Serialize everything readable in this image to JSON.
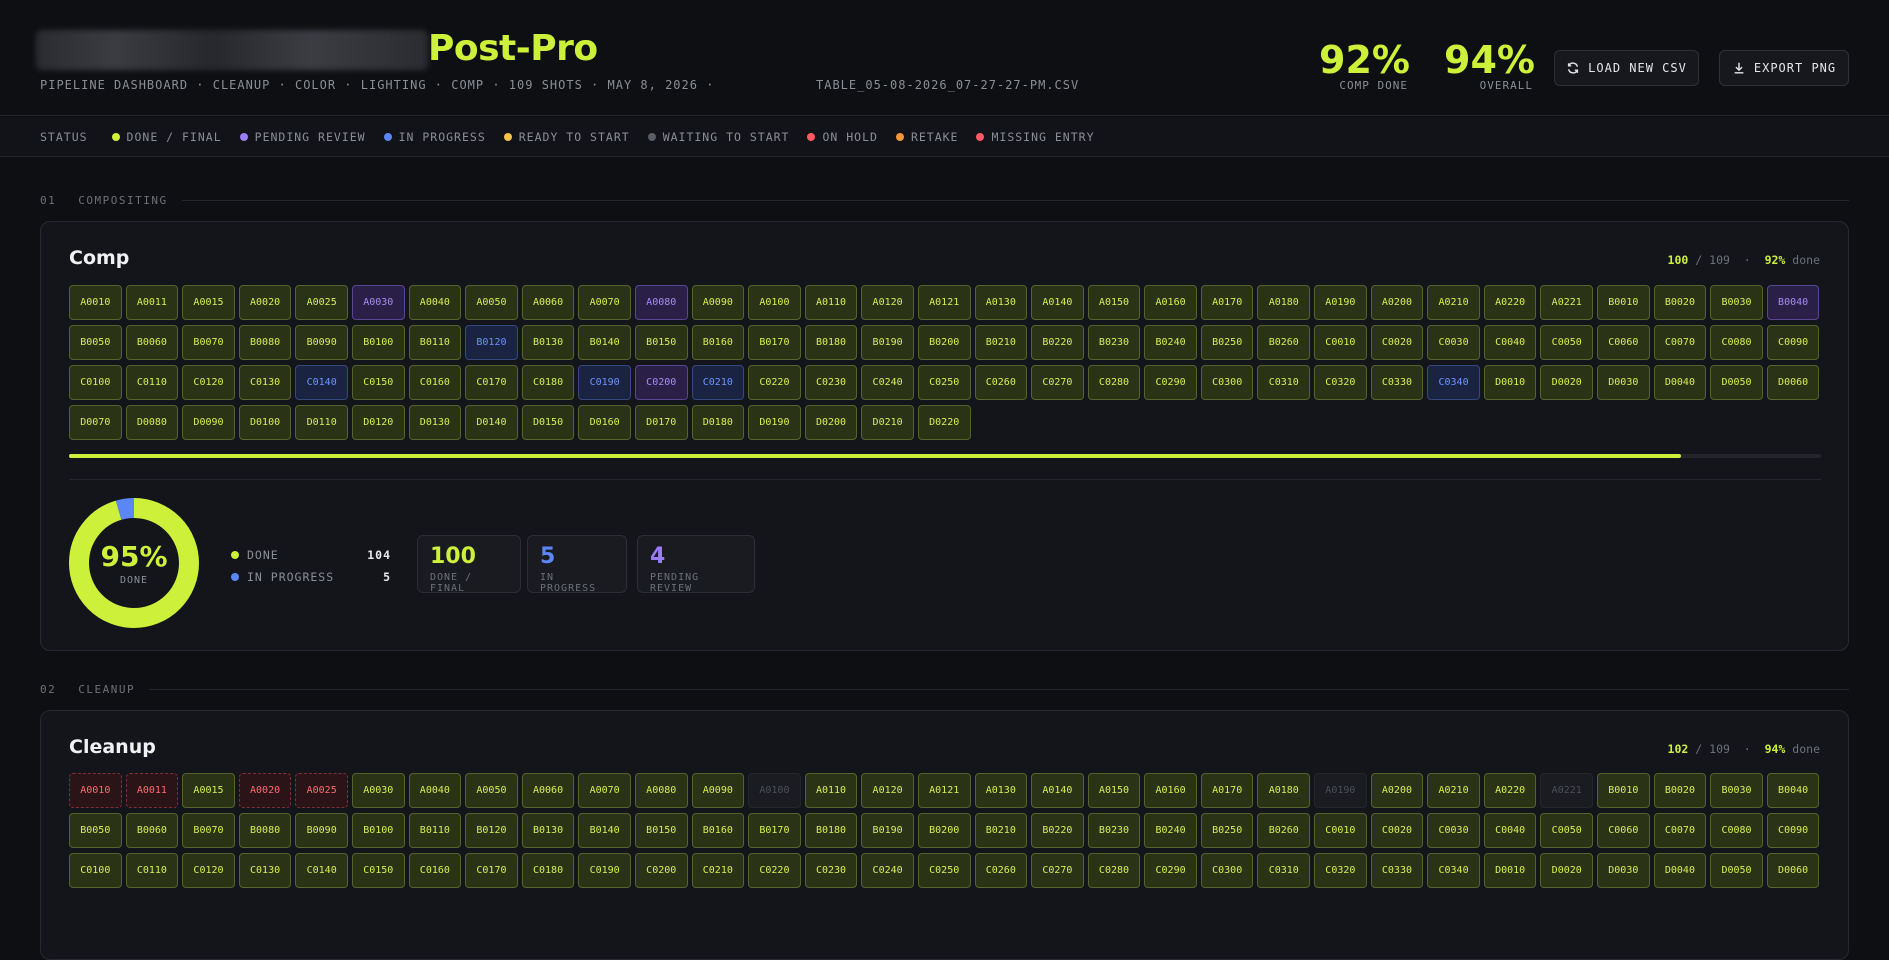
{
  "header": {
    "title": "Post-Pro",
    "subtitle": "PIPELINE DASHBOARD · CLEANUP · COLOR · LIGHTING · COMP · 109 SHOTS · MAY 8, 2026 ·",
    "filename": "TABLE_05-08-2026_07-27-27-PM.CSV",
    "comp_done_value": "92%",
    "comp_done_label": "COMP DONE",
    "overall_value": "94%",
    "overall_label": "OVERALL",
    "load_label": "LOAD NEW CSV",
    "export_label": "EXPORT PNG",
    "load_icon": "refresh-icon",
    "export_icon": "download-icon"
  },
  "legend": {
    "label": "STATUS",
    "items": [
      {
        "label": "DONE / FINAL",
        "color": "#cdf03a"
      },
      {
        "label": "PENDING REVIEW",
        "color": "#9b7cf4"
      },
      {
        "label": "IN PROGRESS",
        "color": "#5b86f5"
      },
      {
        "label": "READY TO START",
        "color": "#f2c14e"
      },
      {
        "label": "WAITING TO START",
        "color": "#5a5d66"
      },
      {
        "label": "ON HOLD",
        "color": "#ff5a5f"
      },
      {
        "label": "RETAKE",
        "color": "#f5953a"
      },
      {
        "label": "MISSING ENTRY",
        "color": "#ff5a67"
      }
    ]
  },
  "sections": [
    {
      "num": "01",
      "label": "COMPOSITING",
      "title": "Comp",
      "count_done": "100",
      "count_sep": "/",
      "count_total": "109",
      "dot_sep": "·",
      "pct": "92%",
      "pct_suffix": "done",
      "progress": 0.92,
      "shots": [
        {
          "id": "A0010",
          "s": "done"
        },
        {
          "id": "A0011",
          "s": "done"
        },
        {
          "id": "A0015",
          "s": "done"
        },
        {
          "id": "A0020",
          "s": "done"
        },
        {
          "id": "A0025",
          "s": "done"
        },
        {
          "id": "A0030",
          "s": "pending"
        },
        {
          "id": "A0040",
          "s": "done"
        },
        {
          "id": "A0050",
          "s": "done"
        },
        {
          "id": "A0060",
          "s": "done"
        },
        {
          "id": "A0070",
          "s": "done"
        },
        {
          "id": "A0080",
          "s": "pending"
        },
        {
          "id": "A0090",
          "s": "done"
        },
        {
          "id": "A0100",
          "s": "done"
        },
        {
          "id": "A0110",
          "s": "done"
        },
        {
          "id": "A0120",
          "s": "done"
        },
        {
          "id": "A0121",
          "s": "done"
        },
        {
          "id": "A0130",
          "s": "done"
        },
        {
          "id": "A0140",
          "s": "done"
        },
        {
          "id": "A0150",
          "s": "done"
        },
        {
          "id": "A0160",
          "s": "done"
        },
        {
          "id": "A0170",
          "s": "done"
        },
        {
          "id": "A0180",
          "s": "done"
        },
        {
          "id": "A0190",
          "s": "done"
        },
        {
          "id": "A0200",
          "s": "done"
        },
        {
          "id": "A0210",
          "s": "done"
        },
        {
          "id": "A0220",
          "s": "done"
        },
        {
          "id": "A0221",
          "s": "done"
        },
        {
          "id": "B0010",
          "s": "done"
        },
        {
          "id": "B0020",
          "s": "done"
        },
        {
          "id": "B0030",
          "s": "done"
        },
        {
          "id": "B0040",
          "s": "pending"
        },
        {
          "id": "B0050",
          "s": "done"
        },
        {
          "id": "B0060",
          "s": "done"
        },
        {
          "id": "B0070",
          "s": "done"
        },
        {
          "id": "B0080",
          "s": "done"
        },
        {
          "id": "B0090",
          "s": "done"
        },
        {
          "id": "B0100",
          "s": "done"
        },
        {
          "id": "B0110",
          "s": "done"
        },
        {
          "id": "B0120",
          "s": "progress"
        },
        {
          "id": "B0130",
          "s": "done"
        },
        {
          "id": "B0140",
          "s": "done"
        },
        {
          "id": "B0150",
          "s": "done"
        },
        {
          "id": "B0160",
          "s": "done"
        },
        {
          "id": "B0170",
          "s": "done"
        },
        {
          "id": "B0180",
          "s": "done"
        },
        {
          "id": "B0190",
          "s": "done"
        },
        {
          "id": "B0200",
          "s": "done"
        },
        {
          "id": "B0210",
          "s": "done"
        },
        {
          "id": "B0220",
          "s": "done"
        },
        {
          "id": "B0230",
          "s": "done"
        },
        {
          "id": "B0240",
          "s": "done"
        },
        {
          "id": "B0250",
          "s": "done"
        },
        {
          "id": "B0260",
          "s": "done"
        },
        {
          "id": "C0010",
          "s": "done"
        },
        {
          "id": "C0020",
          "s": "done"
        },
        {
          "id": "C0030",
          "s": "done"
        },
        {
          "id": "C0040",
          "s": "done"
        },
        {
          "id": "C0050",
          "s": "done"
        },
        {
          "id": "C0060",
          "s": "done"
        },
        {
          "id": "C0070",
          "s": "done"
        },
        {
          "id": "C0080",
          "s": "done"
        },
        {
          "id": "C0090",
          "s": "done"
        },
        {
          "id": "C0100",
          "s": "done"
        },
        {
          "id": "C0110",
          "s": "done"
        },
        {
          "id": "C0120",
          "s": "done"
        },
        {
          "id": "C0130",
          "s": "done"
        },
        {
          "id": "C0140",
          "s": "progress"
        },
        {
          "id": "C0150",
          "s": "done"
        },
        {
          "id": "C0160",
          "s": "done"
        },
        {
          "id": "C0170",
          "s": "done"
        },
        {
          "id": "C0180",
          "s": "done"
        },
        {
          "id": "C0190",
          "s": "progress"
        },
        {
          "id": "C0200",
          "s": "pending"
        },
        {
          "id": "C0210",
          "s": "progress"
        },
        {
          "id": "C0220",
          "s": "done"
        },
        {
          "id": "C0230",
          "s": "done"
        },
        {
          "id": "C0240",
          "s": "done"
        },
        {
          "id": "C0250",
          "s": "done"
        },
        {
          "id": "C0260",
          "s": "done"
        },
        {
          "id": "C0270",
          "s": "done"
        },
        {
          "id": "C0280",
          "s": "done"
        },
        {
          "id": "C0290",
          "s": "done"
        },
        {
          "id": "C0300",
          "s": "done"
        },
        {
          "id": "C0310",
          "s": "done"
        },
        {
          "id": "C0320",
          "s": "done"
        },
        {
          "id": "C0330",
          "s": "done"
        },
        {
          "id": "C0340",
          "s": "progress"
        },
        {
          "id": "D0010",
          "s": "done"
        },
        {
          "id": "D0020",
          "s": "done"
        },
        {
          "id": "D0030",
          "s": "done"
        },
        {
          "id": "D0040",
          "s": "done"
        },
        {
          "id": "D0050",
          "s": "done"
        },
        {
          "id": "D0060",
          "s": "done"
        },
        {
          "id": "D0070",
          "s": "done"
        },
        {
          "id": "D0080",
          "s": "done"
        },
        {
          "id": "D0090",
          "s": "done"
        },
        {
          "id": "D0100",
          "s": "done"
        },
        {
          "id": "D0110",
          "s": "done"
        },
        {
          "id": "D0120",
          "s": "done"
        },
        {
          "id": "D0130",
          "s": "done"
        },
        {
          "id": "D0140",
          "s": "done"
        },
        {
          "id": "D0150",
          "s": "done"
        },
        {
          "id": "D0160",
          "s": "done"
        },
        {
          "id": "D0170",
          "s": "done"
        },
        {
          "id": "D0180",
          "s": "done"
        },
        {
          "id": "D0190",
          "s": "done"
        },
        {
          "id": "D0200",
          "s": "done"
        },
        {
          "id": "D0210",
          "s": "done"
        },
        {
          "id": "D0220",
          "s": "done"
        }
      ],
      "donut": {
        "value": "95%",
        "label": "DONE",
        "done_fraction": 0.954,
        "progress_fraction": 0.046,
        "done_color": "#cdf03a",
        "progress_color": "#5b86f5"
      },
      "stats": [
        {
          "label": "DONE",
          "value": "104",
          "color": "#cdf03a"
        },
        {
          "label": "IN PROGRESS",
          "value": "5",
          "color": "#5b86f5"
        }
      ],
      "cards": [
        {
          "value": "100",
          "label": "DONE / FINAL",
          "color": "#cdf03a"
        },
        {
          "value": "5",
          "label": "IN PROGRESS",
          "color": "#5b86f5"
        },
        {
          "value": "4",
          "label": "PENDING REVIEW",
          "color": "#9b7cf4"
        }
      ]
    },
    {
      "num": "02",
      "label": "CLEANUP",
      "title": "Cleanup",
      "count_done": "102",
      "count_sep": "/",
      "count_total": "109",
      "dot_sep": "·",
      "pct": "94%",
      "pct_suffix": "done",
      "shots": [
        {
          "id": "A0010",
          "s": "hold"
        },
        {
          "id": "A0011",
          "s": "hold"
        },
        {
          "id": "A0015",
          "s": "done"
        },
        {
          "id": "A0020",
          "s": "hold"
        },
        {
          "id": "A0025",
          "s": "hold"
        },
        {
          "id": "A0030",
          "s": "done"
        },
        {
          "id": "A0040",
          "s": "done"
        },
        {
          "id": "A0050",
          "s": "done"
        },
        {
          "id": "A0060",
          "s": "done"
        },
        {
          "id": "A0070",
          "s": "done"
        },
        {
          "id": "A0080",
          "s": "done"
        },
        {
          "id": "A0090",
          "s": "done"
        },
        {
          "id": "A0100",
          "s": "waiting"
        },
        {
          "id": "A0110",
          "s": "done"
        },
        {
          "id": "A0120",
          "s": "done"
        },
        {
          "id": "A0121",
          "s": "done"
        },
        {
          "id": "A0130",
          "s": "done"
        },
        {
          "id": "A0140",
          "s": "done"
        },
        {
          "id": "A0150",
          "s": "done"
        },
        {
          "id": "A0160",
          "s": "done"
        },
        {
          "id": "A0170",
          "s": "done"
        },
        {
          "id": "A0180",
          "s": "done"
        },
        {
          "id": "A0190",
          "s": "waiting"
        },
        {
          "id": "A0200",
          "s": "done"
        },
        {
          "id": "A0210",
          "s": "done"
        },
        {
          "id": "A0220",
          "s": "done"
        },
        {
          "id": "A0221",
          "s": "waiting"
        },
        {
          "id": "B0010",
          "s": "done"
        },
        {
          "id": "B0020",
          "s": "done"
        },
        {
          "id": "B0030",
          "s": "done"
        },
        {
          "id": "B0040",
          "s": "done"
        },
        {
          "id": "B0050",
          "s": "done"
        },
        {
          "id": "B0060",
          "s": "done"
        },
        {
          "id": "B0070",
          "s": "done"
        },
        {
          "id": "B0080",
          "s": "done"
        },
        {
          "id": "B0090",
          "s": "done"
        },
        {
          "id": "B0100",
          "s": "done"
        },
        {
          "id": "B0110",
          "s": "done"
        },
        {
          "id": "B0120",
          "s": "done"
        },
        {
          "id": "B0130",
          "s": "done"
        },
        {
          "id": "B0140",
          "s": "done"
        },
        {
          "id": "B0150",
          "s": "done"
        },
        {
          "id": "B0160",
          "s": "done"
        },
        {
          "id": "B0170",
          "s": "done"
        },
        {
          "id": "B0180",
          "s": "done"
        },
        {
          "id": "B0190",
          "s": "done"
        },
        {
          "id": "B0200",
          "s": "done"
        },
        {
          "id": "B0210",
          "s": "done"
        },
        {
          "id": "B0220",
          "s": "done"
        },
        {
          "id": "B0230",
          "s": "done"
        },
        {
          "id": "B0240",
          "s": "done"
        },
        {
          "id": "B0250",
          "s": "done"
        },
        {
          "id": "B0260",
          "s": "done"
        },
        {
          "id": "C0010",
          "s": "done"
        },
        {
          "id": "C0020",
          "s": "done"
        },
        {
          "id": "C0030",
          "s": "done"
        },
        {
          "id": "C0040",
          "s": "done"
        },
        {
          "id": "C0050",
          "s": "done"
        },
        {
          "id": "C0060",
          "s": "done"
        },
        {
          "id": "C0070",
          "s": "done"
        },
        {
          "id": "C0080",
          "s": "done"
        },
        {
          "id": "C0090",
          "s": "done"
        },
        {
          "id": "C0100",
          "s": "done"
        },
        {
          "id": "C0110",
          "s": "done"
        },
        {
          "id": "C0120",
          "s": "done"
        },
        {
          "id": "C0130",
          "s": "done"
        },
        {
          "id": "C0140",
          "s": "done"
        },
        {
          "id": "C0150",
          "s": "done"
        },
        {
          "id": "C0160",
          "s": "done"
        },
        {
          "id": "C0170",
          "s": "done"
        },
        {
          "id": "C0180",
          "s": "done"
        },
        {
          "id": "C0190",
          "s": "done"
        },
        {
          "id": "C0200",
          "s": "done"
        },
        {
          "id": "C0210",
          "s": "done"
        },
        {
          "id": "C0220",
          "s": "done"
        },
        {
          "id": "C0230",
          "s": "done"
        },
        {
          "id": "C0240",
          "s": "done"
        },
        {
          "id": "C0250",
          "s": "done"
        },
        {
          "id": "C0260",
          "s": "done"
        },
        {
          "id": "C0270",
          "s": "done"
        },
        {
          "id": "C0280",
          "s": "done"
        },
        {
          "id": "C0290",
          "s": "done"
        },
        {
          "id": "C0300",
          "s": "done"
        },
        {
          "id": "C0310",
          "s": "done"
        },
        {
          "id": "C0320",
          "s": "done"
        },
        {
          "id": "C0330",
          "s": "done"
        },
        {
          "id": "C0340",
          "s": "done"
        },
        {
          "id": "D0010",
          "s": "done"
        },
        {
          "id": "D0020",
          "s": "done"
        },
        {
          "id": "D0030",
          "s": "done"
        },
        {
          "id": "D0040",
          "s": "done"
        },
        {
          "id": "D0050",
          "s": "done"
        },
        {
          "id": "D0060",
          "s": "done"
        }
      ]
    }
  ]
}
